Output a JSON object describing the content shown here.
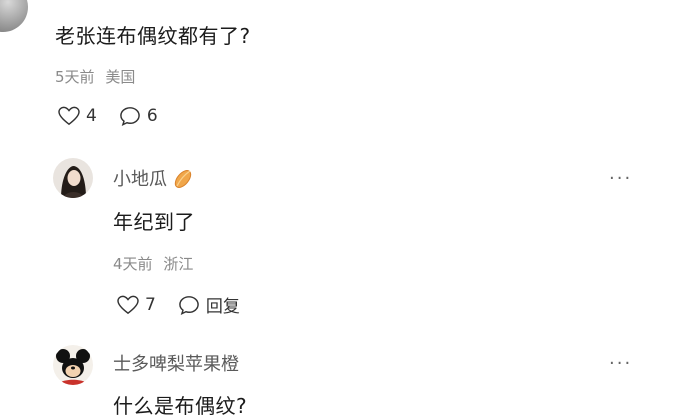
{
  "comment_main": {
    "text": "老张连布偶纹都有了?",
    "time": "5天前",
    "location": "美国",
    "likes": "4",
    "replies": "6"
  },
  "reply1": {
    "username": "小地瓜",
    "text": "年纪到了",
    "time": "4天前",
    "location": "浙江",
    "likes": "7",
    "reply_label": "回复"
  },
  "reply2": {
    "username": "士多啤梨苹果橙",
    "text": "什么是布偶纹?"
  },
  "icons": {
    "like": "heart-icon",
    "comment": "comment-bubble-icon",
    "more": "more-dots-icon",
    "badge": "sweet-potato-icon"
  },
  "colors": {
    "meta_text": "#8a8a8a",
    "body_text": "#1b1b1b",
    "username_text": "#5a5a5a"
  }
}
